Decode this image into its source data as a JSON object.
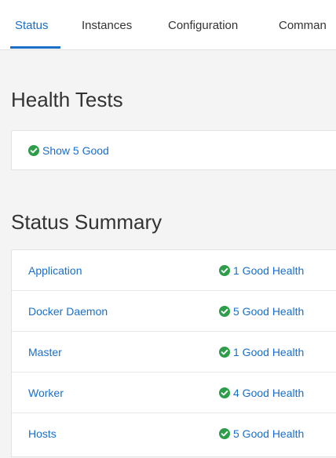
{
  "tabs": [
    {
      "label": "Status",
      "active": true
    },
    {
      "label": "Instances",
      "active": false
    },
    {
      "label": "Configuration",
      "active": false
    },
    {
      "label": "Comman",
      "active": false
    }
  ],
  "health_tests": {
    "title": "Health Tests",
    "show_good_label": "Show 5 Good",
    "icon": "check-circle-icon"
  },
  "status_summary": {
    "title": "Status Summary",
    "rows": [
      {
        "name": "Application",
        "health": "1 Good Health"
      },
      {
        "name": "Docker Daemon",
        "health": "5 Good Health"
      },
      {
        "name": "Master",
        "health": "1 Good Health"
      },
      {
        "name": "Worker",
        "health": "4 Good Health"
      },
      {
        "name": "Hosts",
        "health": "5 Good Health"
      }
    ]
  },
  "colors": {
    "accent": "#1a6fc9",
    "good": "#2e9d4a",
    "background": "#f4f4f4"
  }
}
